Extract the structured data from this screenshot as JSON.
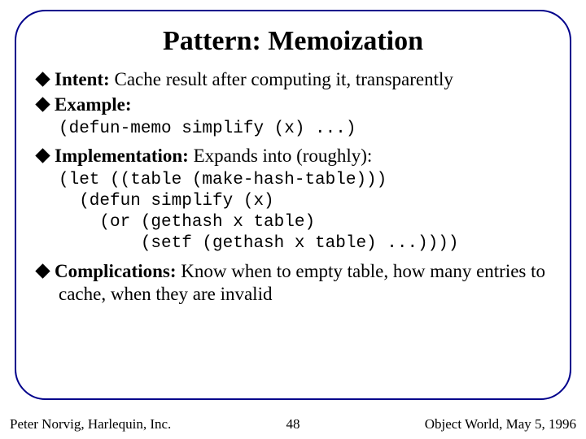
{
  "title": "Pattern: Memoization",
  "items": {
    "intent": {
      "label": "Intent:",
      "text": " Cache result after computing it, transparently"
    },
    "example": {
      "label": "Example:",
      "code": "(defun-memo simplify (x) ...)"
    },
    "implementation": {
      "label": "Implementation:",
      "text": " Expands into (roughly):",
      "code": "(let ((table (make-hash-table)))\n  (defun simplify (x)\n    (or (gethash x table)\n        (setf (gethash x table) ...))))"
    },
    "complications": {
      "label": "Complications:",
      "text": " Know when to empty table, how many entries to cache, when they are invalid"
    }
  },
  "footer": {
    "left": "Peter Norvig, Harlequin, Inc.",
    "center": "48",
    "right": "Object World, May 5, 1996"
  }
}
